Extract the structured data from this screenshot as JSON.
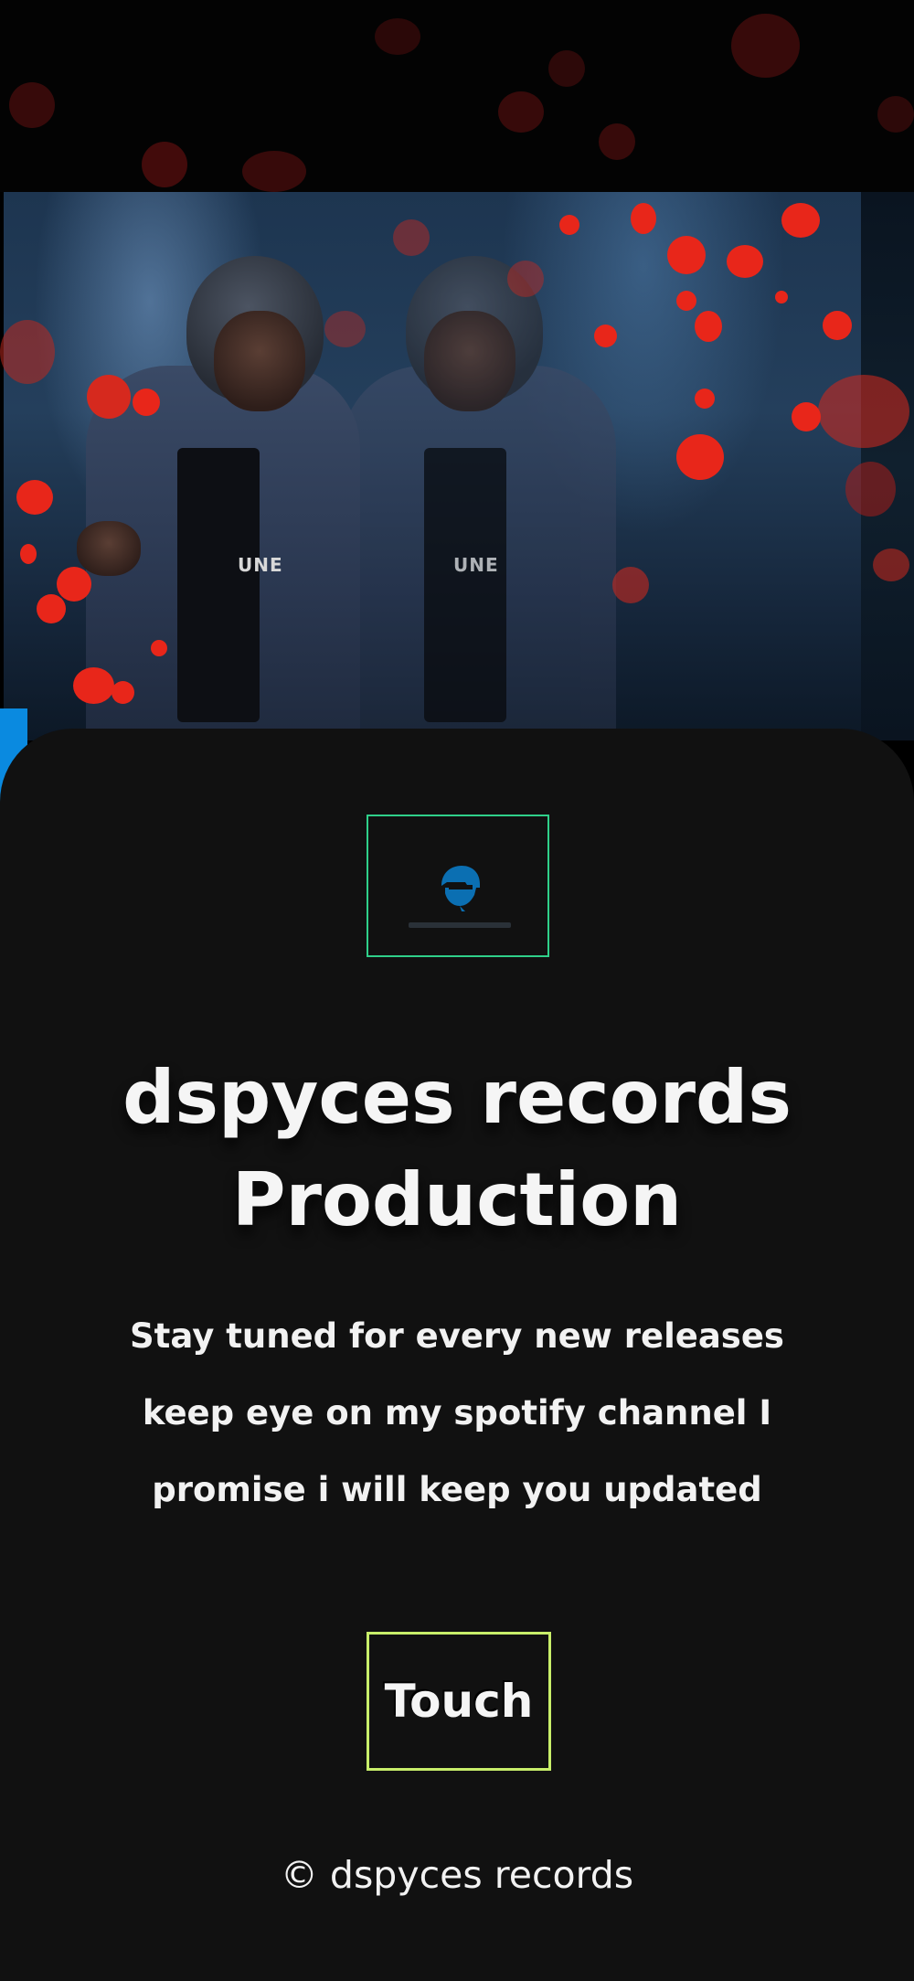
{
  "hero": {
    "image_description_icon": "hooded-figure-photo",
    "shirt_print": "UNE"
  },
  "logo": {
    "icon": "helmet-logo-icon",
    "color": "#0b6fb2",
    "border_color": "#2fd08a"
  },
  "headline": {
    "line1": "dspyces records",
    "line2": "Production"
  },
  "tagline": {
    "line1": "Stay tuned for every new releases",
    "line2": "keep eye on my spotify channel I",
    "line3": "promise i will keep you updated"
  },
  "cta": {
    "label": "Touch",
    "border_color": "#c8ee6a"
  },
  "footer": {
    "text": "© dspyces records"
  },
  "colors": {
    "background": "#111111",
    "bokeh": "#e8261a",
    "accent_blue": "#0a8ae0"
  }
}
